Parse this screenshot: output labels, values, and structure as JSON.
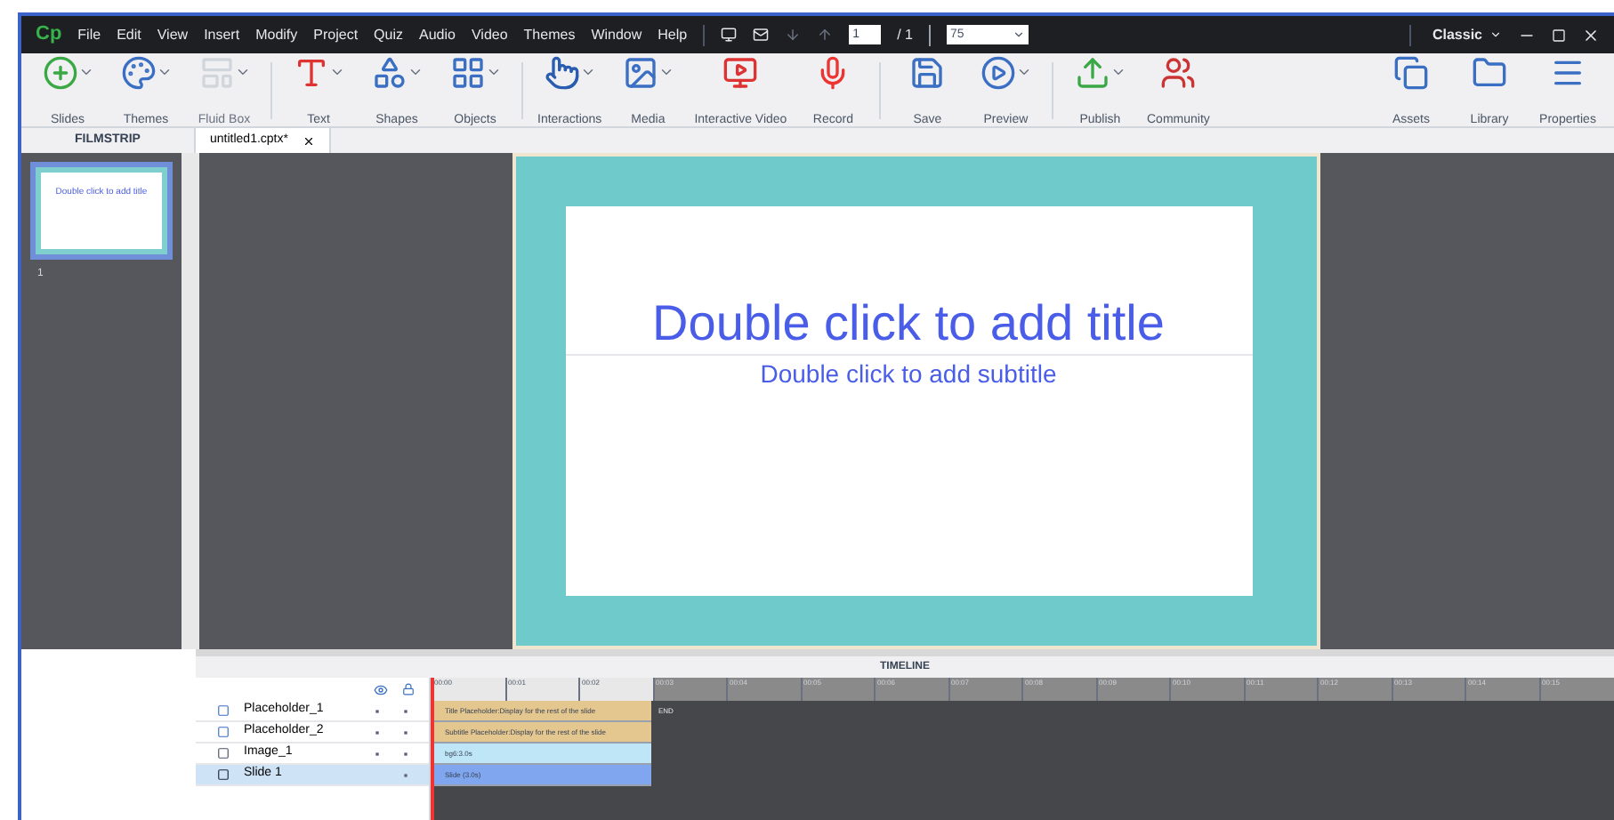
{
  "app": {
    "logo": "Cp",
    "menu": [
      "File",
      "Edit",
      "View",
      "Insert",
      "Modify",
      "Project",
      "Quiz",
      "Audio",
      "Video",
      "Themes",
      "Window",
      "Help"
    ],
    "slide_number": "1",
    "slide_total": "/ 1",
    "zoom": "75",
    "workspace": "Classic"
  },
  "toolbar": [
    {
      "label": "Slides",
      "dropdown": true,
      "disabled": false
    },
    {
      "label": "Themes",
      "dropdown": true,
      "disabled": false
    },
    {
      "label": "Fluid Box",
      "dropdown": true,
      "disabled": true
    },
    {
      "label": "Text",
      "dropdown": true,
      "disabled": false
    },
    {
      "label": "Shapes",
      "dropdown": true,
      "disabled": false
    },
    {
      "label": "Objects",
      "dropdown": true,
      "disabled": false
    },
    {
      "label": "Interactions",
      "dropdown": true,
      "disabled": false
    },
    {
      "label": "Media",
      "dropdown": true,
      "disabled": false
    },
    {
      "label": "Interactive Video",
      "dropdown": false,
      "disabled": false
    },
    {
      "label": "Record",
      "dropdown": false,
      "disabled": false
    },
    {
      "label": "Save",
      "dropdown": false,
      "disabled": false
    },
    {
      "label": "Preview",
      "dropdown": true,
      "disabled": false
    },
    {
      "label": "Publish",
      "dropdown": true,
      "disabled": false
    },
    {
      "label": "Community",
      "dropdown": false,
      "disabled": false
    }
  ],
  "toolbar_right": [
    {
      "label": "Assets"
    },
    {
      "label": "Library"
    },
    {
      "label": "Properties"
    }
  ],
  "filmstrip": {
    "title": "FILMSTRIP",
    "slides": [
      {
        "number": "1",
        "title": "Double click to add title",
        "selected": true
      }
    ]
  },
  "tabs": [
    {
      "label": "untitled1.cptx*",
      "selected": true
    }
  ],
  "slide": {
    "title": "Double click to add title",
    "subtitle": "Double click to add subtitle"
  },
  "timeline": {
    "title": "TIMELINE",
    "ticks": [
      "00:00",
      "00:01",
      "00:02",
      "00:03",
      "00:04",
      "00:05",
      "00:06",
      "00:07",
      "00:08",
      "00:09",
      "00:10",
      "00:11",
      "00:12",
      "00:13",
      "00:14",
      "00:15"
    ],
    "end_label": "END",
    "rows": [
      {
        "name": "Placeholder_1",
        "kind": "placeholder",
        "bar": "Title Placeholder:Display for the rest of the slide",
        "visible": true,
        "lockable": true,
        "selected": false
      },
      {
        "name": "Placeholder_2",
        "kind": "placeholder",
        "bar": "Subtitle Placeholder:Display for the rest of the slide",
        "visible": true,
        "lockable": true,
        "selected": false
      },
      {
        "name": "Image_1",
        "kind": "image",
        "bar": "bg6:3.0s",
        "visible": true,
        "lockable": true,
        "selected": false
      },
      {
        "name": "Slide 1",
        "kind": "slide",
        "bar": "Slide (3.0s)",
        "visible": false,
        "lockable": true,
        "selected": true
      }
    ]
  }
}
